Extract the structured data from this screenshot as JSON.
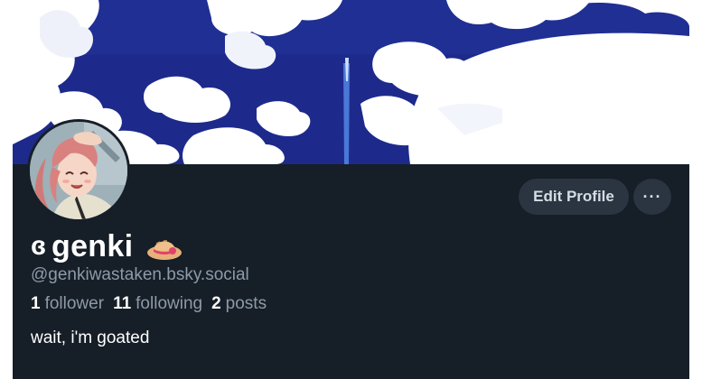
{
  "profile": {
    "display_name_glyph": "ɞ",
    "display_name": "genki",
    "display_name_emoji": "hat-emoji-icon",
    "handle": "@genkiwastaken.bsky.social",
    "bio": "wait, i'm goated"
  },
  "stats": {
    "followers_count": "1",
    "followers_label": "follower",
    "following_count": "11",
    "following_label": "following",
    "posts_count": "2",
    "posts_label": "posts"
  },
  "actions": {
    "edit_profile_label": "Edit Profile",
    "more_label": "···"
  },
  "colors": {
    "background": "#161e27",
    "banner_sky": "#1d2a8c",
    "button_bg": "#2a3541",
    "muted_text": "#8d9aa8"
  }
}
